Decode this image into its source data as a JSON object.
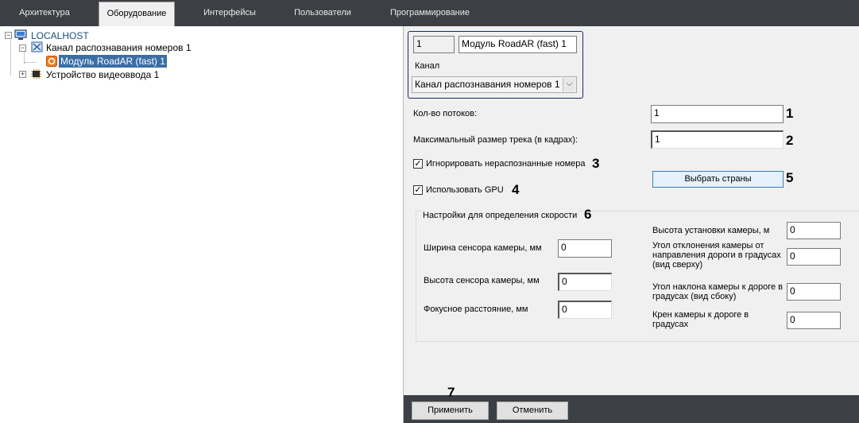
{
  "tabs": [
    {
      "label": "Архитектура"
    },
    {
      "label": "Оборудование"
    },
    {
      "label": "Интерфейсы"
    },
    {
      "label": "Пользователи"
    },
    {
      "label": "Программирование"
    }
  ],
  "tree": {
    "root": "LOCALHOST",
    "channel": "Канал распознавания номеров 1",
    "module": "Модуль RoadAR (fast) 1",
    "video_device": "Устройство видеоввода 1"
  },
  "header": {
    "id_value": "1",
    "name_value": "Модуль RoadAR (fast) 1",
    "channel_label": "Канал",
    "channel_select": "Канал распознавания номеров 1"
  },
  "settings": {
    "streams_label": "Кол-во потоков:",
    "streams_value": "1",
    "track_label": "Максимальный размер трека (в кадрах):",
    "track_value": "1",
    "ignore_label": "Игнорировать нераспознанные номера",
    "ignore_checked": true,
    "gpu_label": "Использовать GPU",
    "gpu_checked": true,
    "countries_button": "Выбрать страны"
  },
  "speed": {
    "group_label": "Настройки для определения скорости",
    "sensor_width_label": "Ширина сенсора камеры, мм",
    "sensor_width_value": "0",
    "sensor_height_label": "Высота сенсора камеры, мм",
    "sensor_height_value": "0",
    "focal_label": "Фокусное расстояние, мм",
    "focal_value": "0",
    "cam_height_label": "Высота установки камеры, м",
    "cam_height_value": "0",
    "yaw_label": "Угол отклонения камеры от направления дороги в градусах (вид сверху)",
    "yaw_value": "0",
    "pitch_label": "Угол наклона камеры к дороге в градусах (вид сбоку)",
    "pitch_value": "0",
    "roll_label": "Крен камеры к дороге в градусах",
    "roll_value": "0"
  },
  "markers": {
    "m1": "1",
    "m2": "2",
    "m3": "3",
    "m4": "4",
    "m5": "5",
    "m6": "6",
    "m7": "7"
  },
  "footer": {
    "apply": "Применить",
    "cancel": "Отменить"
  },
  "colors": {
    "tab_bar": "#3c3f44",
    "panel_bg": "#f0f0f0",
    "tree_selected": "#3a6ea5",
    "header_border": "#1c2a5c"
  }
}
